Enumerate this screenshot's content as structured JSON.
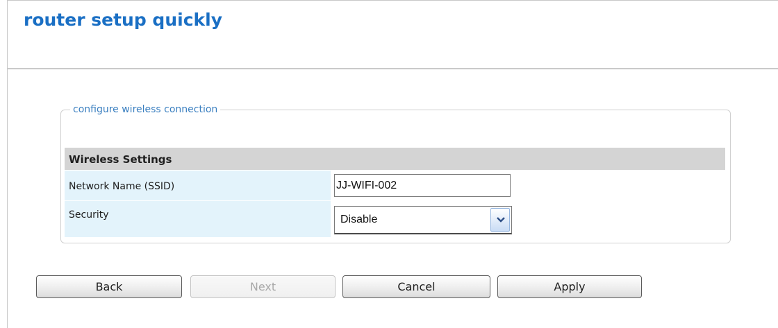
{
  "header": {
    "title": "router setup quickly"
  },
  "group": {
    "legend": "configure wireless connection",
    "section_title": "Wireless Settings",
    "fields": {
      "ssid": {
        "label": "Network Name (SSID)",
        "value": "JJ-WIFI-002"
      },
      "security": {
        "label": "Security",
        "value": "Disable"
      }
    }
  },
  "buttons": {
    "back": "Back",
    "next": "Next",
    "cancel": "Cancel",
    "apply": "Apply"
  },
  "icons": {
    "select_arrow": "chevron-down-icon"
  },
  "colors": {
    "title": "#1a6fc4",
    "legend": "#3a7fc0",
    "section_header_bg": "#d4d4d4",
    "label_bg": "#e3f3fb"
  }
}
